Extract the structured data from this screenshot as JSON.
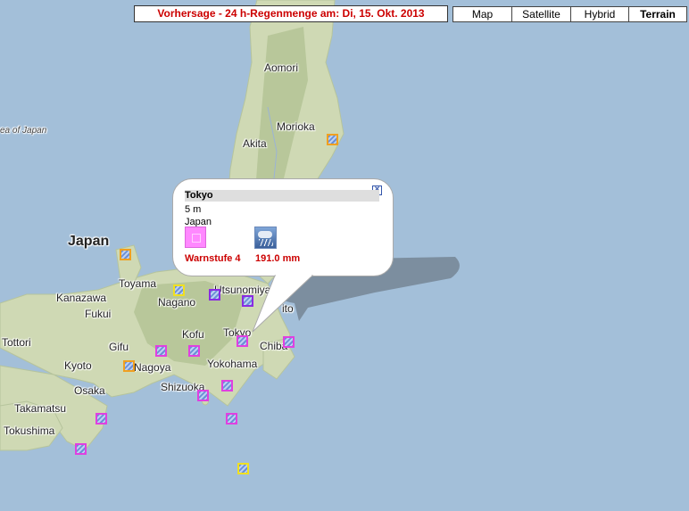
{
  "header": {
    "forecast_title": "Vorhersage - 24 h-Regenmenge am: Di, 15. Okt. 2013"
  },
  "map_types": {
    "map": "Map",
    "satellite": "Satellite",
    "hybrid": "Hybrid",
    "terrain": "Terrain",
    "active": "Terrain"
  },
  "map_labels": {
    "aomori": "Aomori",
    "morioka": "Morioka",
    "akita": "Akita",
    "sea_of_japan": "ea of Japan",
    "japan": "Japan",
    "toyama": "Toyama",
    "kanazawa": "Kanazawa",
    "nagano": "Nagano",
    "utsunomiya": "Utsunomiya",
    "mito": "ito",
    "fukui": "Fukui",
    "tottori": "Tottori",
    "gifu": "Gifu",
    "kofu": "Kofu",
    "tokyo": "Tokyo",
    "chiba": "Chiba",
    "kyoto": "Kyoto",
    "nagoya": "Nagoya",
    "yokohama": "Yokohama",
    "osaka": "Osaka",
    "shizuoka": "Shizuoka",
    "takamatsu": "Takamatsu",
    "tokushima": "Tokushima"
  },
  "infowindow": {
    "station": "Tokyo",
    "elevation": "5 m",
    "country": "Japan",
    "warning_label": "Warnstufe 4",
    "rain_amount": "191.0  mm",
    "close_symbol": "×"
  },
  "colors": {
    "water": "#a3bfd9",
    "land": "#cfd9b4",
    "highland": "#b8c79a",
    "warning_text": "#cc0000"
  }
}
